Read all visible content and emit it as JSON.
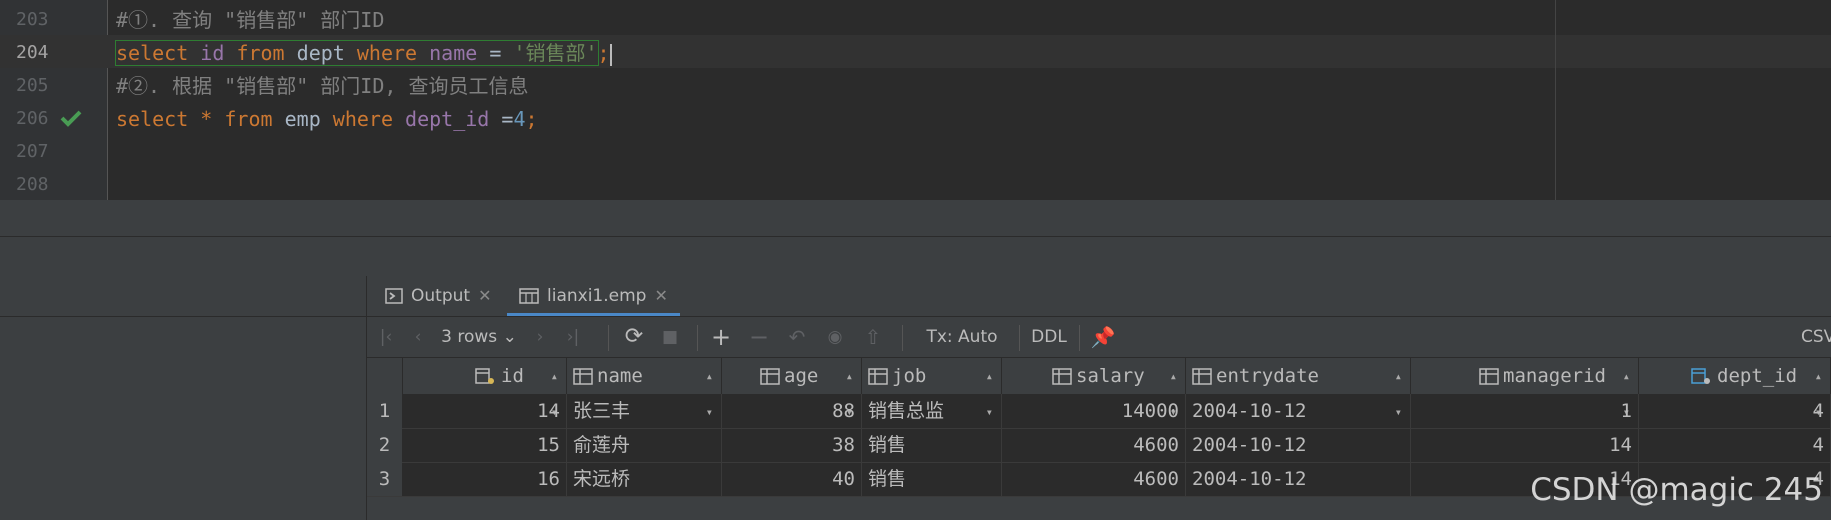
{
  "editor": {
    "lines": [
      {
        "number": "203",
        "text": "#①. 查询 \"销售部\" 部门ID"
      },
      {
        "number": "204",
        "kw1": "select",
        "col": "id",
        "kw2": "from",
        "table": "dept",
        "kw3": "where",
        "col2": "name",
        "op": "=",
        "str": "'销售部'",
        "semi": ";"
      },
      {
        "number": "205",
        "text": "#②. 根据 \"销售部\" 部门ID, 查询员工信息"
      },
      {
        "number": "206",
        "kw1": "select",
        "star": "*",
        "kw2": "from",
        "table": "emp",
        "kw3": "where",
        "col": "dept_id",
        "op": "=",
        "num": "4",
        "semi": ";",
        "status_icon": "check-icon"
      },
      {
        "number": "207"
      },
      {
        "number": "208"
      }
    ]
  },
  "tabs": [
    {
      "label": "Output",
      "icon": "console-icon"
    },
    {
      "label": "lianxi1.emp",
      "icon": "table-icon"
    }
  ],
  "toolbar": {
    "rows": "3 rows",
    "tx": "Tx: Auto",
    "ddl": "DDL",
    "csv": "CSV"
  },
  "table": {
    "columns": [
      "id",
      "name",
      "age",
      "job",
      "salary",
      "entrydate",
      "managerid",
      "dept_id"
    ],
    "rows": [
      {
        "n": "1",
        "cells": [
          "14",
          "张三丰",
          "88",
          "销售总监",
          "14000",
          "2004-10-12",
          "1",
          "4"
        ]
      },
      {
        "n": "2",
        "cells": [
          "15",
          "俞莲舟",
          "38",
          "销售",
          "4600",
          "2004-10-12",
          "14",
          "4"
        ]
      },
      {
        "n": "3",
        "cells": [
          "16",
          "宋远桥",
          "40",
          "销售",
          "4600",
          "2004-10-12",
          "14",
          "4"
        ]
      }
    ]
  },
  "watermark": "CSDN @magic 245",
  "colors": {
    "keyword": "#cc7832",
    "identifier": "#9876aa",
    "string": "#6a8759",
    "number": "#6897bb",
    "accent": "#4a88c7",
    "check": "#499c54"
  }
}
